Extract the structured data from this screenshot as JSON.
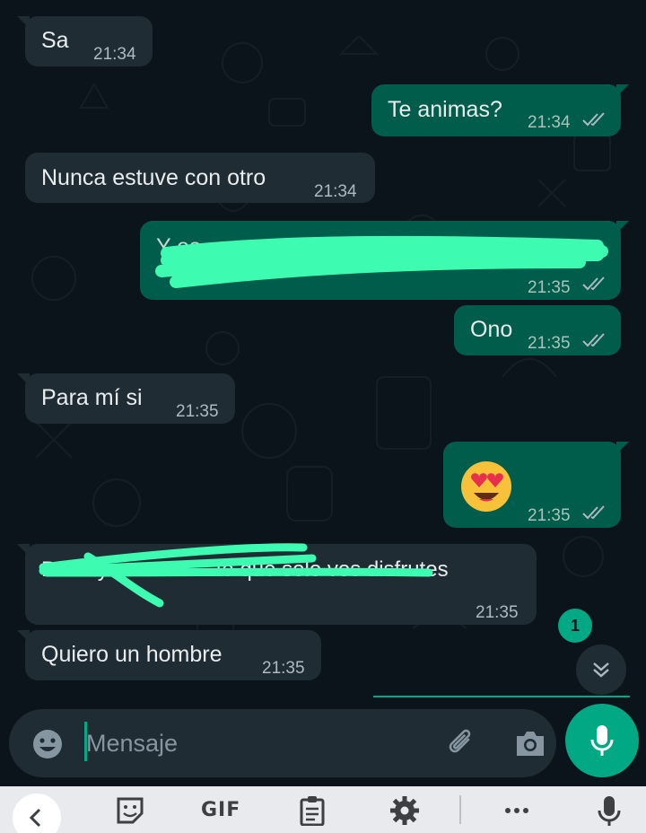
{
  "colors": {
    "background": "#0b141a",
    "incoming_bubble": "#202c33",
    "outgoing_bubble": "#005c4b",
    "accent": "#00a884",
    "scribble": "#3dfcb1",
    "keyboard_bar": "#e8eaed"
  },
  "messages": [
    {
      "direction": "incoming",
      "text": "Sa",
      "time": "21:34"
    },
    {
      "direction": "outgoing",
      "text": "Te animas?",
      "time": "21:34",
      "status": "read"
    },
    {
      "direction": "incoming",
      "text": "Nunca estuve con otro",
      "time": "21:34"
    },
    {
      "direction": "outgoing",
      "text": "Y es ............................................o",
      "time": "21:35",
      "status": "read",
      "redacted": true
    },
    {
      "direction": "outgoing",
      "text": "Ono",
      "time": "21:35",
      "status": "read"
    },
    {
      "direction": "incoming",
      "text": "Para mí si",
      "time": "21:35"
    },
    {
      "direction": "outgoing",
      "emoji": "heart-eyes-emoji",
      "time": "21:35",
      "status": "read"
    },
    {
      "direction": "incoming",
      "text": "Per... ya no.......... te que solo vos disfrutes",
      "time": "21:35",
      "redacted": true
    },
    {
      "direction": "incoming",
      "text": "Quiero un hombre",
      "time": "21:35"
    }
  ],
  "unread_badge": "1",
  "composer": {
    "placeholder": "Mensaje",
    "icons": [
      "emoji-icon",
      "attach-icon",
      "camera-icon",
      "mic-icon"
    ]
  },
  "keyboard_toolbar": {
    "gif_label": "GIF",
    "icons": [
      "back-chevron-icon",
      "sticker-icon",
      "clipboard-icon",
      "settings-icon",
      "more-icon",
      "voice-input-icon"
    ]
  }
}
